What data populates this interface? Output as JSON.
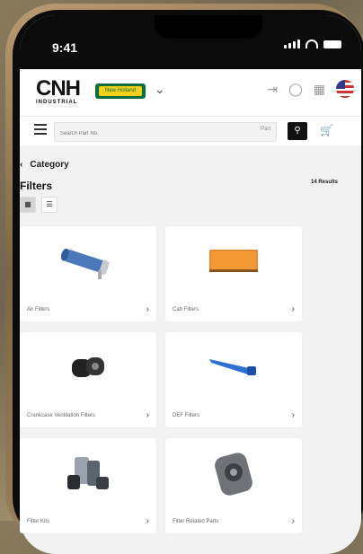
{
  "status": {
    "time": "9:41"
  },
  "header": {
    "logo_text": "CNH",
    "logo_sub": "INDUSTRIAL",
    "brand_logo": "New Holland"
  },
  "search": {
    "placeholder": "Search Part No.",
    "filter_label": "Part"
  },
  "breadcrumb": {
    "back_label": "Category"
  },
  "page": {
    "title": "Filters",
    "results": "14 Results"
  },
  "categories": [
    {
      "label": "Air Filters"
    },
    {
      "label": "Cab Filters"
    },
    {
      "label": "Crankcase Ventilation Filters"
    },
    {
      "label": "DEF Filters"
    },
    {
      "label": "Filter Kits"
    },
    {
      "label": "Filter Related Parts"
    }
  ]
}
